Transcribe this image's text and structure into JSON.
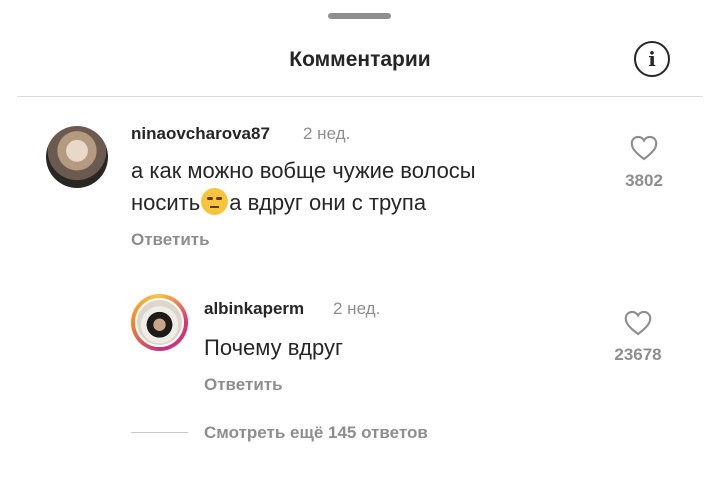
{
  "header": {
    "title": "Комментарии",
    "info_icon": "info-icon"
  },
  "comments": [
    {
      "username": "ninaovcharova87",
      "time": "2 нед.",
      "text_line1": "а как можно вобще чужие волосы",
      "text_line2_before": "носить",
      "text_line2_after": "а вдруг они с трупа",
      "emoji": "face-with-rolling-eyes",
      "reply_label": "Ответить",
      "likes": "3802"
    },
    {
      "username": "albinkaperm",
      "time": "2 нед.",
      "text": "Почему вдруг",
      "reply_label": "Ответить",
      "likes": "23678"
    }
  ],
  "view_more": "Смотреть ещё 145 ответов"
}
